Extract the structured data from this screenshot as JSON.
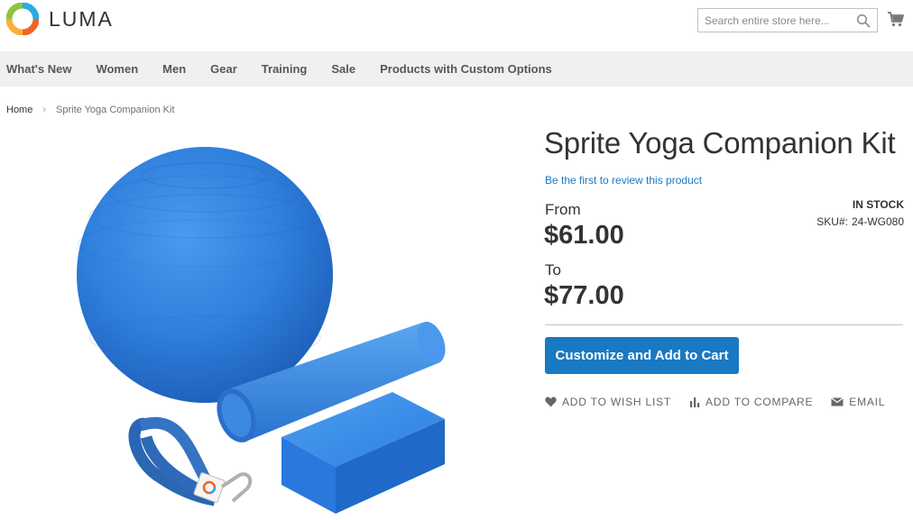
{
  "header": {
    "logo_text": "LUMA",
    "search_placeholder": "Search entire store here..."
  },
  "nav": {
    "items": [
      "What's New",
      "Women",
      "Men",
      "Gear",
      "Training",
      "Sale",
      "Products with Custom Options"
    ]
  },
  "breadcrumb": {
    "home": "Home",
    "separator": "›",
    "current": "Sprite Yoga Companion Kit"
  },
  "product": {
    "title": "Sprite Yoga Companion Kit",
    "review_link": "Be the first to review this product",
    "from_label": "From",
    "price_from": "$61.00",
    "to_label": "To",
    "price_to": "$77.00",
    "stock_status": "IN STOCK",
    "sku_label": "SKU#:",
    "sku_value": "24-WG080",
    "add_button": "Customize and Add to Cart",
    "actions": {
      "wishlist": "Add to Wish List",
      "compare": "Add to Compare",
      "email": "Email"
    }
  },
  "colors": {
    "accent": "#1979c3",
    "nav_bg": "#f0f0f0",
    "product_blue": "#2b7de0"
  },
  "icons": [
    "luma-logo-icon",
    "search-icon",
    "cart-icon",
    "heart-icon",
    "compare-icon",
    "email-icon"
  ]
}
